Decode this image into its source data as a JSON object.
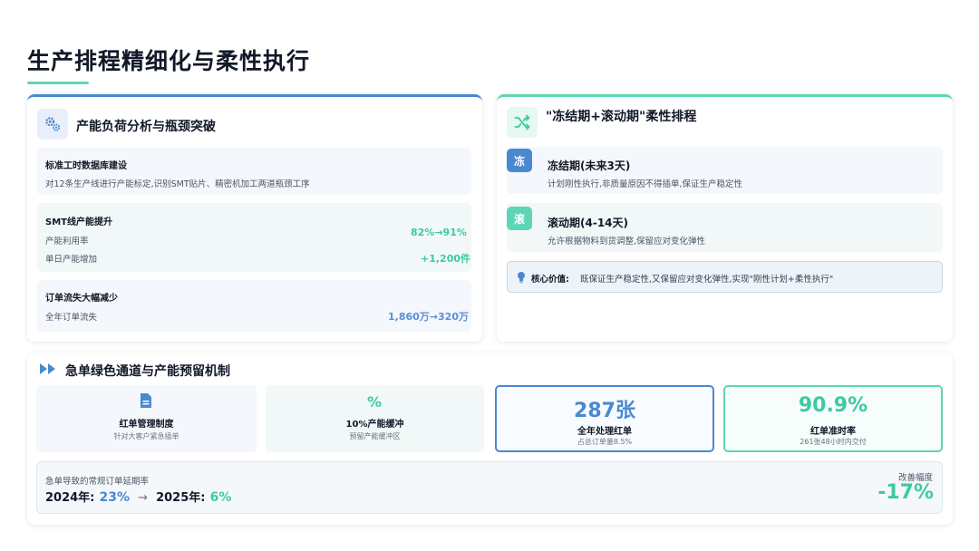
{
  "page_title": "生产排程精细化与柔性执行",
  "left_card": {
    "icon": "gears-icon",
    "title": "产能负荷分析与瓶颈突破",
    "sections": {
      "standard": {
        "title": "标准工时数据库建设",
        "desc": "对12条生产线进行产能标定,识别SMT贴片、精密机加工两道瓶颈工序"
      },
      "smt": {
        "title": "SMT线产能提升",
        "row1_label": "产能利用率",
        "row1_value": "82%→91%",
        "row2_label": "单日产能增加",
        "row2_value": "+1,200件"
      },
      "loss": {
        "title": "订单流失大幅减少",
        "row1_label": "全年订单流失",
        "row1_value": "1,860万→320万"
      }
    }
  },
  "right_card": {
    "icon": "shuffle-icon",
    "title": "\"冻结期+滚动期\"柔性排程",
    "freeze": {
      "badge": "冻",
      "title": "冻结期(未来3天)",
      "desc": "计划刚性执行,非质量原因不得插单,保证生产稳定性"
    },
    "rolling": {
      "badge": "滚",
      "title": "滚动期(4-14天)",
      "desc": "允许根据物料到货调整,保留应对变化弹性"
    },
    "core": {
      "icon": "lightbulb-icon",
      "label": "核心价值:",
      "text": "既保证生产稳定性,又保留应对变化弹性,实现\"刚性计划+柔性执行\""
    }
  },
  "bottom_card": {
    "icon": "fast-forward-icon",
    "title": "急单绿色通道与产能预留机制",
    "tiles": {
      "red": {
        "icon": "document-icon",
        "title": "红单管理制度",
        "sub": "针对大客户紧急插单"
      },
      "buffer": {
        "icon": "percent-icon",
        "title": "10%产能缓冲",
        "sub": "预留产能缓冲区"
      },
      "count": {
        "value": "287张",
        "title": "全年处理红单",
        "sub": "占总订单量8.5%"
      },
      "ontime": {
        "value": "90.9%",
        "title": "红单准时率",
        "sub": "261张48小时内交付"
      }
    },
    "rate": {
      "label": "急单导致的常规订单延期率",
      "y2024_label": "2024年:",
      "y2024_value": "23%",
      "arrow": "→",
      "y2025_label": "2025年:",
      "y2025_value": "6%",
      "improve_label": "改善幅度",
      "improve_value": "-17%"
    }
  },
  "colors": {
    "blue": "#4a89d0",
    "teal": "#5ed6b6",
    "teal_text": "#3fc9a3",
    "blue_text": "#5b8ed6"
  }
}
